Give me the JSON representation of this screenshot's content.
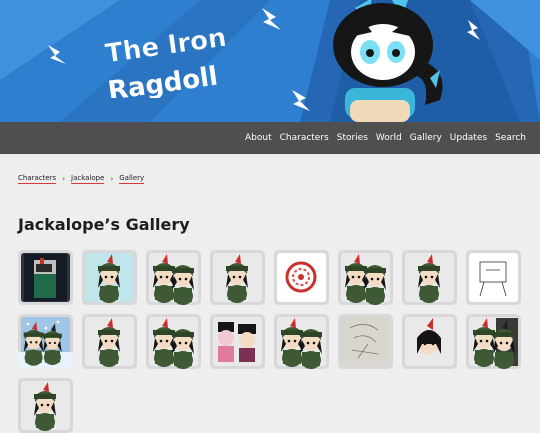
{
  "site": {
    "logo_line1": "The Iron",
    "logo_line2": "Ragdoll"
  },
  "colors": {
    "banner": "#2f7fd0",
    "navbar": "#4f4f4f",
    "accent": "#d33a3a",
    "page_bg": "#eeeeee"
  },
  "nav": [
    {
      "label": "About"
    },
    {
      "label": "Characters"
    },
    {
      "label": "Stories"
    },
    {
      "label": "World"
    },
    {
      "label": "Gallery"
    },
    {
      "label": "Updates"
    },
    {
      "label": "Search"
    }
  ],
  "breadcrumb": [
    {
      "label": "Characters"
    },
    {
      "label": "Jackalope"
    },
    {
      "label": "Gallery"
    }
  ],
  "page_title": "Jackalope’s Gallery",
  "gallery": [
    {
      "kind": "dark-pixel",
      "bg": "#2b3340"
    },
    {
      "kind": "soldier",
      "bg": "#bfe6ea"
    },
    {
      "kind": "soldier-pair",
      "bg": "#e9e9e9"
    },
    {
      "kind": "soldier",
      "bg": "#e9e9e9"
    },
    {
      "kind": "red-swirl",
      "bg": "#ffffff"
    },
    {
      "kind": "soldier-pair",
      "bg": "#e9e9e9"
    },
    {
      "kind": "soldier",
      "bg": "#e9e9e9"
    },
    {
      "kind": "sketch",
      "bg": "#ffffff"
    },
    {
      "kind": "snow",
      "bg": "#9fc6e6"
    },
    {
      "kind": "soldier",
      "bg": "#e9e9e9"
    },
    {
      "kind": "soldier-pair",
      "bg": "#e9e9e9"
    },
    {
      "kind": "pink-pair",
      "bg": "#e9e9e9"
    },
    {
      "kind": "soldier-pair",
      "bg": "#e9e9e9"
    },
    {
      "kind": "pencil",
      "bg": "#d9d6cf"
    },
    {
      "kind": "head",
      "bg": "#e9e9e9"
    },
    {
      "kind": "dark-pair",
      "bg": "#e9e9e9"
    },
    {
      "kind": "soldier",
      "bg": "#e9e9e9"
    }
  ]
}
